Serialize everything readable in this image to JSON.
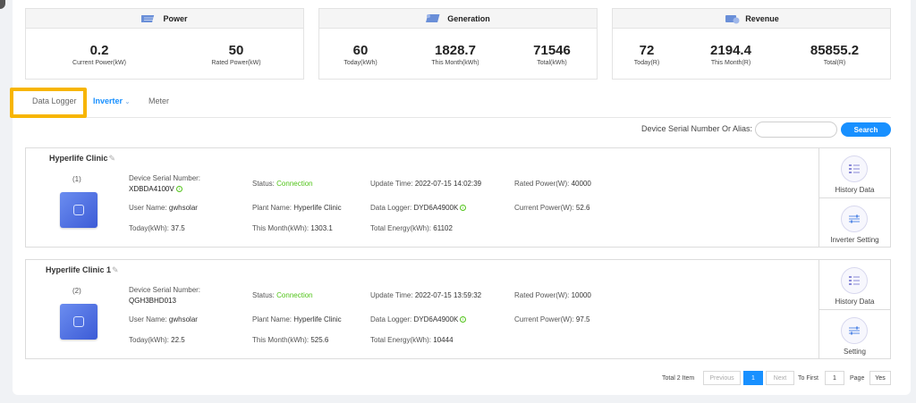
{
  "summary": {
    "power": {
      "title": "Power",
      "metrics": [
        {
          "value": "0.2",
          "label": "Current Power(kW)"
        },
        {
          "value": "50",
          "label": "Rated Power(kW)"
        }
      ]
    },
    "generation": {
      "title": "Generation",
      "metrics": [
        {
          "value": "60",
          "label": "Today(kWh)"
        },
        {
          "value": "1828.7",
          "label": "This Month(kWh)"
        },
        {
          "value": "71546",
          "label": "Total(kWh)"
        }
      ]
    },
    "revenue": {
      "title": "Revenue",
      "metrics": [
        {
          "value": "72",
          "label": "Today(R)"
        },
        {
          "value": "2194.4",
          "label": "This Month(R)"
        },
        {
          "value": "85855.2",
          "label": "Total(R)"
        }
      ]
    }
  },
  "tabs": {
    "data_logger": "Data Logger",
    "inverter": "Inverter",
    "meter": "Meter"
  },
  "search": {
    "label": "Device Serial Number Or Alias:",
    "placeholder": "",
    "button": "Search"
  },
  "devices": [
    {
      "name": "Hyperlife Clinic",
      "index": "(1)",
      "serial_label": "Device Serial Number:",
      "serial": "XDBDA4100V",
      "user_label": "User Name:",
      "user": "gwhsolar",
      "today_label": "Today(kWh):",
      "today": "37.5",
      "status_label": "Status:",
      "status": "Connection",
      "plant_label": "Plant Name:",
      "plant": "Hyperlife Clinic",
      "month_label": "This Month(kWh):",
      "month": "1303.1",
      "update_label": "Update Time:",
      "update": "2022-07-15 14:02:39",
      "logger_label": "Data Logger:",
      "logger": "DYD6A4900K",
      "total_label": "Total Energy(kWh):",
      "total": "61102",
      "rated_label": "Rated Power(W):",
      "rated": "40000",
      "current_label": "Current Power(W):",
      "current": "52.6",
      "btn1": "History Data",
      "btn2": "Inverter Setting"
    },
    {
      "name": "Hyperlife Clinic 1",
      "index": "(2)",
      "serial_label": "Device Serial Number:",
      "serial": "QGH3BHD013",
      "user_label": "User Name:",
      "user": "gwhsolar",
      "today_label": "Today(kWh):",
      "today": "22.5",
      "status_label": "Status:",
      "status": "Connection",
      "plant_label": "Plant Name:",
      "plant": "Hyperlife Clinic",
      "month_label": "This Month(kWh):",
      "month": "525.6",
      "update_label": "Update Time:",
      "update": "2022-07-15 13:59:32",
      "logger_label": "Data Logger:",
      "logger": "DYD6A4900K",
      "total_label": "Total Energy(kWh):",
      "total": "10444",
      "rated_label": "Rated Power(W):",
      "rated": "10000",
      "current_label": "Current Power(W):",
      "current": "97.5",
      "btn1": "History Data",
      "btn2": "Setting"
    }
  ],
  "pagination": {
    "total": "Total 2 Item",
    "previous": "Previous",
    "page": "1",
    "next": "Next",
    "to_first": "To First",
    "input": "1",
    "page_label": "Page",
    "yes": "Yes"
  },
  "colors": {
    "accent": "#1890ff",
    "status_ok": "#52c41a",
    "highlight": "#f7b500"
  }
}
